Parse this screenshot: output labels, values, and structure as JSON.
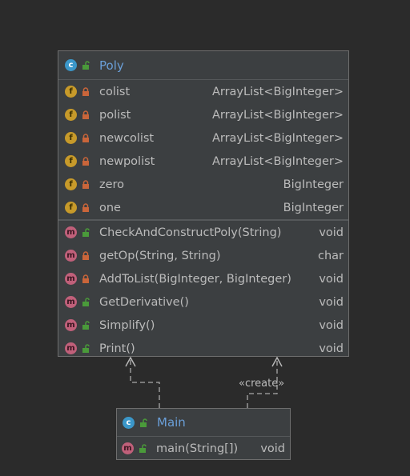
{
  "colors": {
    "background": "#2b2b2b",
    "class_fill": "#3c3f41",
    "class_border": "#6e6e6e",
    "class_name": "#6a9fd8",
    "text": "#bbbbbb",
    "class_badge": "#3b97c9",
    "field_badge": "#c79a2a",
    "method_badge": "#c0607a",
    "public_lock": "#4a9a3a",
    "private_lock": "#c9653a"
  },
  "poly": {
    "badge": "c",
    "name": "Poly",
    "visibility_icon": "unlocked-lock-icon",
    "fields": [
      {
        "badge": "f",
        "visibility": "private",
        "name": "colist",
        "type": "ArrayList<BigInteger>"
      },
      {
        "badge": "f",
        "visibility": "private",
        "name": "polist",
        "type": "ArrayList<BigInteger>"
      },
      {
        "badge": "f",
        "visibility": "private",
        "name": "newcolist",
        "type": "ArrayList<BigInteger>"
      },
      {
        "badge": "f",
        "visibility": "private",
        "name": "newpolist",
        "type": "ArrayList<BigInteger>"
      },
      {
        "badge": "f",
        "visibility": "private",
        "name": "zero",
        "type": "BigInteger"
      },
      {
        "badge": "f",
        "visibility": "private",
        "name": "one",
        "type": "BigInteger"
      }
    ],
    "methods": [
      {
        "badge": "m",
        "visibility": "public",
        "name": "CheckAndConstructPoly(String)",
        "type": "void"
      },
      {
        "badge": "m",
        "visibility": "private",
        "name": "getOp(String, String)",
        "type": "char"
      },
      {
        "badge": "m",
        "visibility": "private",
        "name": "AddToList(BigInteger, BigInteger)",
        "type": "void"
      },
      {
        "badge": "m",
        "visibility": "public",
        "name": "GetDerivative()",
        "type": "void"
      },
      {
        "badge": "m",
        "visibility": "public",
        "name": "Simplify()",
        "type": "void"
      },
      {
        "badge": "m",
        "visibility": "public",
        "name": "Print()",
        "type": "void"
      }
    ]
  },
  "main": {
    "badge": "c",
    "name": "Main",
    "visibility_icon": "unlocked-lock-icon",
    "methods": [
      {
        "badge": "m",
        "visibility": "public",
        "name": "main(String[])",
        "type": "void"
      }
    ]
  },
  "connector": {
    "label": "«create»"
  }
}
